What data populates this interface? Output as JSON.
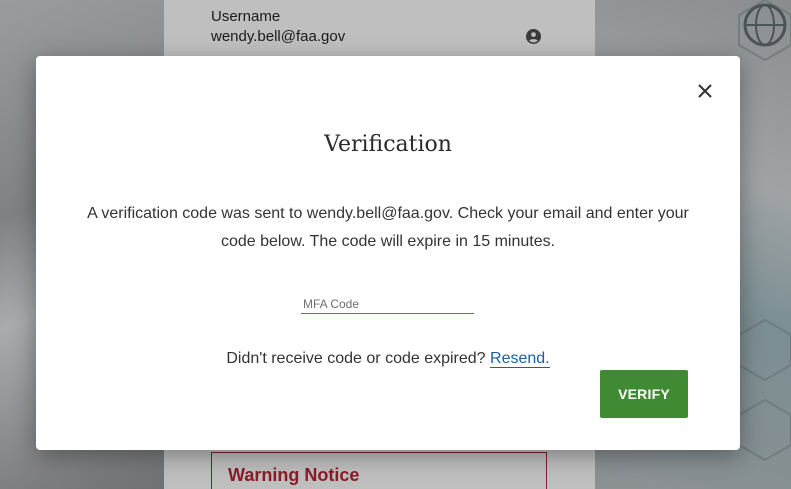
{
  "background": {
    "login": {
      "username_label": "Username",
      "username_value": "wendy.bell@faa.gov",
      "user_icon": "account-circle-icon"
    },
    "warning_title": "Warning Notice"
  },
  "modal": {
    "title": "Verification",
    "message": "A verification code was sent to wendy.bell@faa.gov. Check your email and enter your code below. The code will expire in 15 minutes.",
    "mfa_placeholder": "MFA Code",
    "mfa_value": "",
    "resend_prompt": "Didn't receive code or code expired?",
    "resend_link": "Resend.",
    "verify_label": "VERIFY",
    "close_icon": "close-icon"
  },
  "colors": {
    "primary_green": "#3f8a33",
    "link_blue": "#1d5fa5",
    "warning_red": "#8a1c27"
  }
}
